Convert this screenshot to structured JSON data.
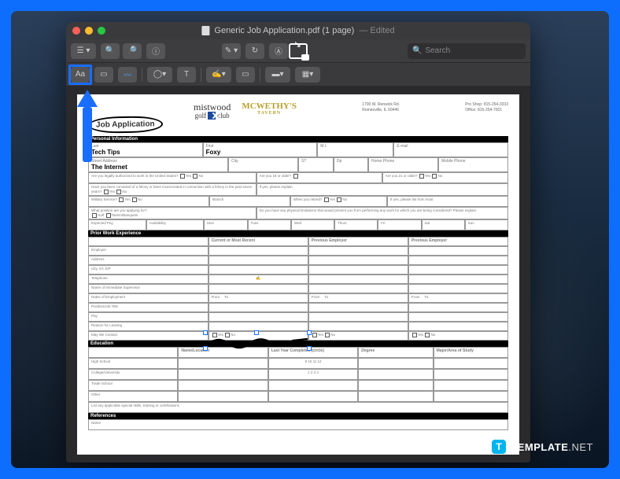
{
  "window": {
    "title": "Generic Job Application.pdf (1 page)",
    "edited_suffix": "— Edited"
  },
  "toolbar": {
    "sidebar": "☰",
    "zoom_out": "−",
    "zoom_in": "+",
    "view": "▢",
    "markup": "✎",
    "rotate": "↻",
    "search_placeholder": "Search",
    "text_tool": "Aa",
    "select": "▭",
    "draw": "〰",
    "shapes": "◯",
    "text_style": "T",
    "sign": "✍",
    "note": "▭",
    "color": "▬",
    "fill": "▦"
  },
  "document": {
    "heading": "Job Application",
    "brand1_top": "mistwood",
    "brand1_bottom_a": "golf",
    "brand1_bottom_b": "club",
    "brand2_top": "MCWETHY'S",
    "brand2_bottom": "TAVERN",
    "contact_addr1": "1700 W. Renwick Rd.",
    "contact_addr2": "Romeoville, IL 60446",
    "contact_phone1": "Pro Shop: 815-254-3333",
    "contact_phone2": "Office: 815-254-7001",
    "sections": {
      "personal": "Personal Information",
      "work_exp": "Prior Work Experience",
      "education": "Education",
      "references": "References"
    },
    "fields": {
      "last_label": "Last",
      "last_value": "Tech Tips",
      "first_label": "First",
      "first_value": "Foxy",
      "mi_label": "M.I.",
      "email_label": "E-mail",
      "street_label": "Street Address",
      "street_value": "The Internet",
      "city_label": "City",
      "st_label": "ST",
      "zip_label": "Zip",
      "homephone_label": "Home Phone",
      "mobile_label": "Mobile Phone",
      "auth_q": "Are you legally authorized to work in the United States?",
      "age18_q": "Are you 18 or older?",
      "age21_q": "Are you 21 or older?",
      "felony_q": "Have you been convicted of a felony or been incarcerated in connection with a felony in the past seven years?",
      "felony_explain": "If yes, please explain",
      "military_label": "Military Service?",
      "branch_label": "Branch",
      "when_retired": "When you retired?",
      "explain2": "If yes, please list from most",
      "position_q": "What position are you applying for?",
      "golf": "Golf",
      "tavern": "Tavern/Banquets",
      "phys_q": "Do you have any physical limitations that would prevent you from performing any work for which you are being considered? Please explain.",
      "expected_pay": "Expected Pay",
      "availability": "Availability",
      "days": [
        "Mon",
        "Tues",
        "Wed",
        "Thurs",
        "Fri",
        "Sat",
        "Sun"
      ]
    },
    "exp": {
      "col1": "Current or Most Recent",
      "col2": "Previous Employer",
      "col3": "Previous Employer",
      "rows": [
        "Employer",
        "Address",
        "City, ST, ZIP",
        "Telephone",
        "Name of Immediate Supervisor",
        "Dates of Employment",
        "Position/Job Title",
        "Pay",
        "Reason for Leaving",
        "May We Contact"
      ],
      "from": "From",
      "to": "To"
    },
    "edu": {
      "cols": [
        "Name/Location",
        "Last Year Completed (circle)",
        "Degree",
        "Major/Area of Study"
      ],
      "rows": [
        "High School",
        "College/University",
        "Trade School",
        "Other"
      ],
      "years1": "9  10  11  12",
      "years2": "1  2  3  4",
      "skills": "List any applicable special skills, training or certifications"
    },
    "ref": {
      "name": "Name"
    }
  },
  "watermark": {
    "brand_a": "TEMPLATE",
    "brand_b": ".NET",
    "icon": "T"
  }
}
